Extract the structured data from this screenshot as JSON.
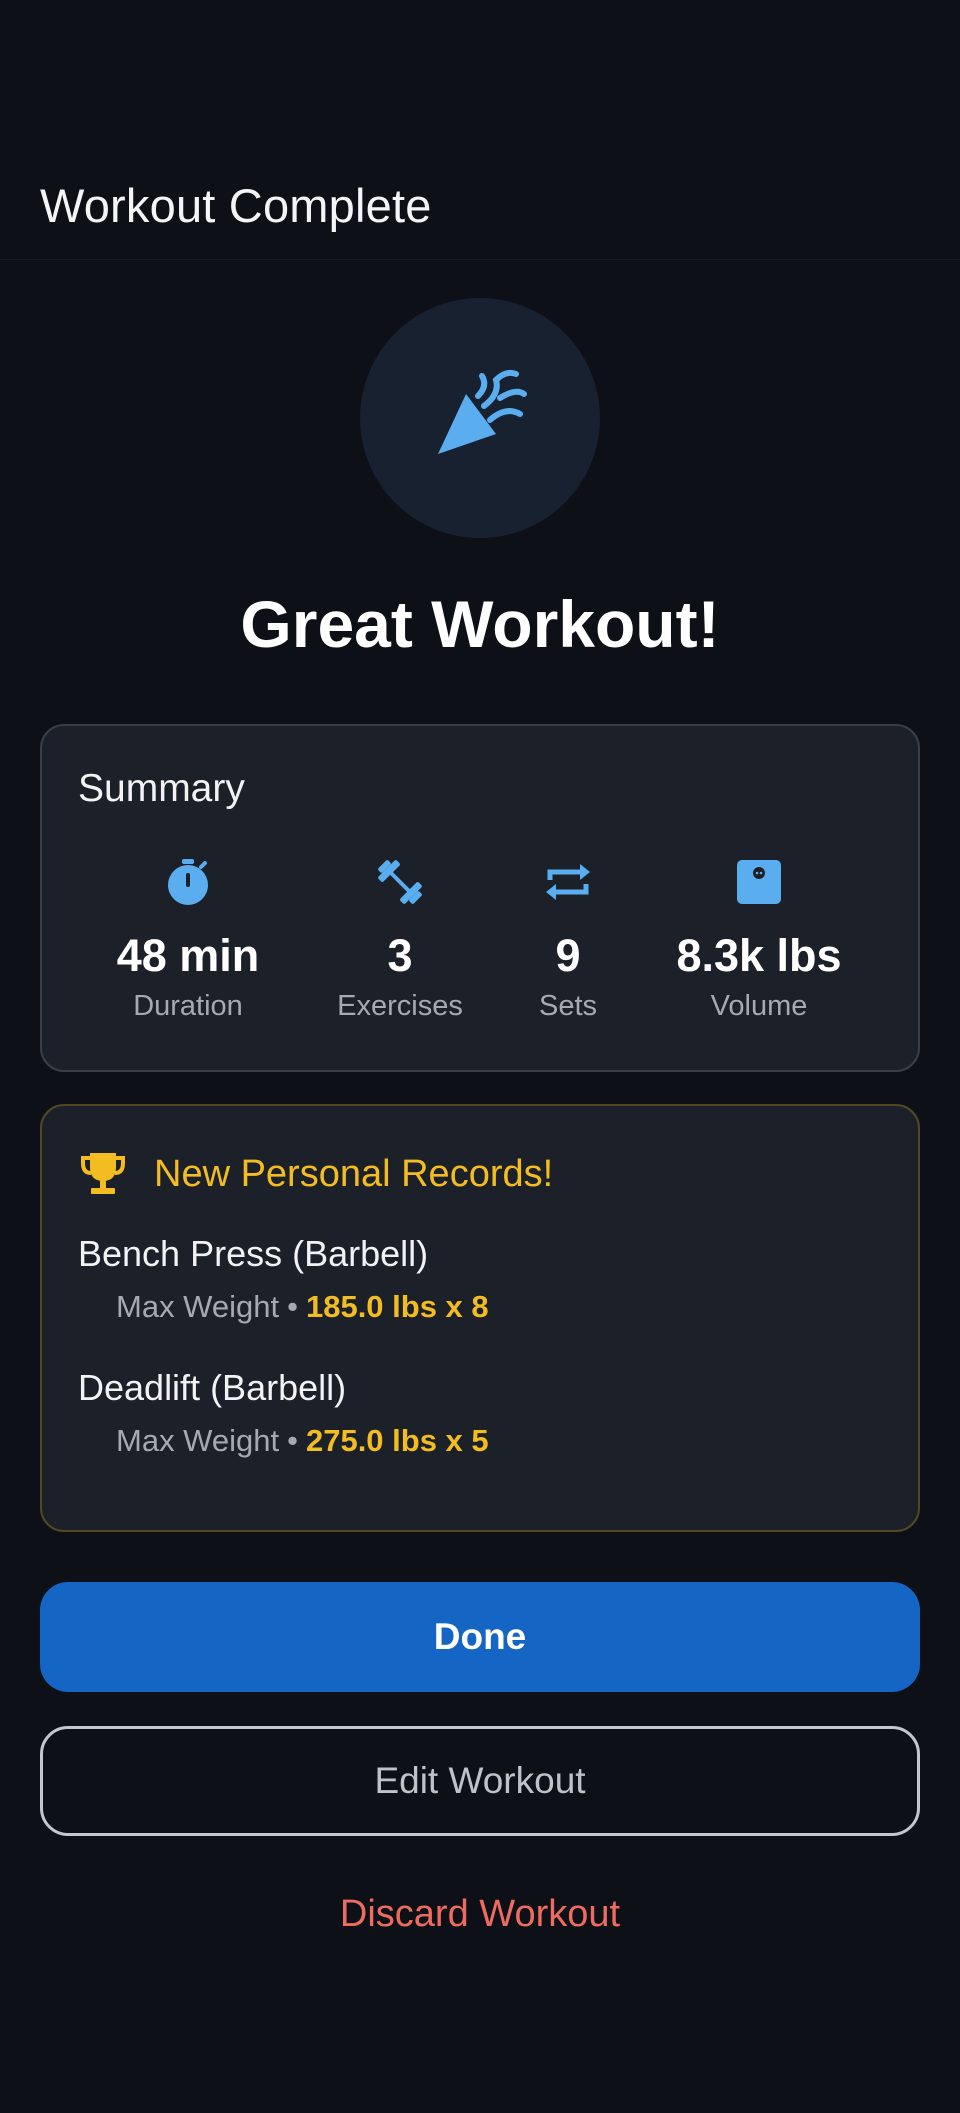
{
  "header": {
    "title": "Workout Complete"
  },
  "hero": {
    "icon": "celebration-icon",
    "headline": "Great Workout!"
  },
  "summary": {
    "title": "Summary",
    "stats": [
      {
        "icon": "timer-icon",
        "value": "48 min",
        "label": "Duration"
      },
      {
        "icon": "dumbbell-icon",
        "value": "3",
        "label": "Exercises"
      },
      {
        "icon": "repeat-icon",
        "value": "9",
        "label": "Sets"
      },
      {
        "icon": "scale-icon",
        "value": "8.3k lbs",
        "label": "Volume"
      }
    ]
  },
  "records": {
    "icon": "trophy-icon",
    "title": "New Personal Records!",
    "items": [
      {
        "exercise": "Bench Press (Barbell)",
        "type": "Max Weight",
        "separator": "•",
        "value": "185.0 lbs x 8"
      },
      {
        "exercise": "Deadlift (Barbell)",
        "type": "Max Weight",
        "separator": "•",
        "value": "275.0 lbs x 5"
      }
    ]
  },
  "actions": {
    "done_label": "Done",
    "edit_label": "Edit Workout",
    "discard_label": "Discard Workout"
  },
  "colors": {
    "background": "#0d1016",
    "card": "#1c2029",
    "accent_blue": "#5aaef0",
    "primary_button": "#1565c4",
    "gold": "#f3bd22",
    "danger": "#ee6b5f"
  }
}
